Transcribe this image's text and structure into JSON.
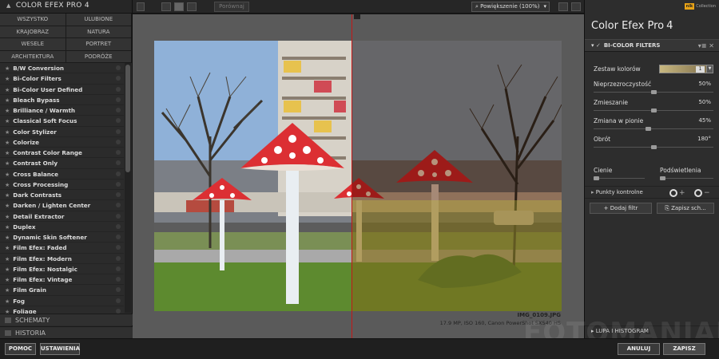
{
  "left_panel": {
    "title": "COLOR EFEX PRO 4",
    "categories": [
      "WSZYSTKO",
      "ULUBIONE",
      "KRAJOBRAZ",
      "NATURA",
      "WESELE",
      "PORTRET",
      "ARCHITEKTURA",
      "PODRÓŻE"
    ],
    "filters": [
      "B/W Conversion",
      "Bi-Color Filters",
      "Bi-Color User Defined",
      "Bleach Bypass",
      "Brilliance / Warmth",
      "Classical Soft Focus",
      "Color Stylizer",
      "Colorize",
      "Contrast Color Range",
      "Contrast Only",
      "Cross Balance",
      "Cross Processing",
      "Dark Contrasts",
      "Darken / Lighten Center",
      "Detail Extractor",
      "Duplex",
      "Dynamic Skin Softener",
      "Film Efex: Faded",
      "Film Efex: Modern",
      "Film Efex: Nostalgic",
      "Film Efex: Vintage",
      "Film Grain",
      "Fog",
      "Foliage"
    ],
    "schematy": "SCHEMATY",
    "historia": "HISTORIA"
  },
  "toolbar": {
    "compare_label": "Porównaj",
    "zoom_label": "Powiększenie (100%)"
  },
  "canvas": {
    "image_name": "IMG_0109.JPG",
    "image_info": "17.9 MP, ISO 160, Canon PowerShot SX540 HS"
  },
  "right_panel": {
    "brand_small": "nik",
    "brand_collection": "Collection",
    "app_name": "Color Efex Pro",
    "app_version": "4",
    "filter_name": "BI-COLOR FILTERS",
    "color_set_label": "Zestaw kolorów",
    "color_set_value": "1",
    "params": [
      {
        "label": "Nieprzezroczystość",
        "value": "50%",
        "pct": 0.5
      },
      {
        "label": "Zmieszanie",
        "value": "50%",
        "pct": 0.5
      },
      {
        "label": "Zmiana w pionie",
        "value": "45%",
        "pct": 0.45
      },
      {
        "label": "Obrót",
        "value": "180°",
        "pct": 0.5
      }
    ],
    "shadows_label": "Cienie",
    "highlights_label": "Podświetlenia",
    "control_points_label": "Punkty kontrolne",
    "add_filter_label": "Dodaj filtr",
    "save_label": "Zapisz sch...",
    "loupe_label": "LUPA I HISTOGRAM"
  },
  "bottom": {
    "help_label": "POMOC",
    "settings_label": "USTAWIENIA",
    "cancel_label": "ANULUJ",
    "save_label": "ZAPISZ"
  },
  "watermark": "FOTOMANIAK",
  "colors": {
    "accent_split": "#c41818",
    "brand_badge": "#e8a317"
  }
}
